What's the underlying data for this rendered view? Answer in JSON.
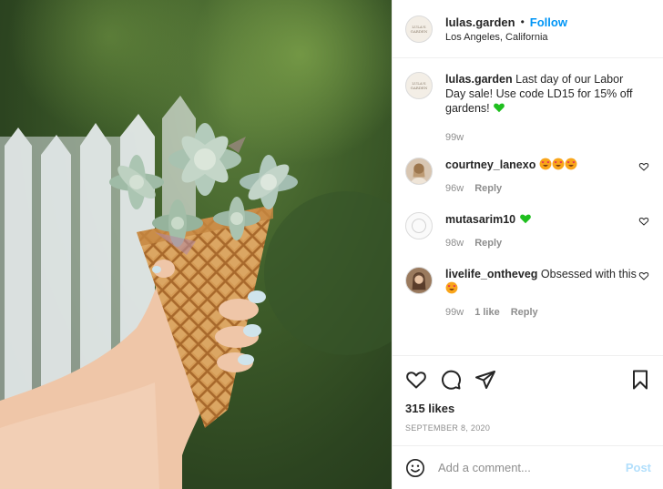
{
  "post": {
    "username": "lulas.garden",
    "dot": "•",
    "follow_label": "Follow",
    "location": "Los Angeles, California",
    "avatar_logo_text": "LULA'S GARDEN"
  },
  "caption": {
    "username": "lulas.garden",
    "text": " Last day of our Labor Day sale! Use code LD15 for 15% off gardens! ",
    "emoji": "green-heart",
    "time": "99w"
  },
  "comments": [
    {
      "username": "courtney_lanexo",
      "text": "",
      "emojis": [
        "heart-eyes",
        "heart-eyes",
        "heart-eyes"
      ],
      "time": "96w",
      "likes": "",
      "reply_label": "Reply"
    },
    {
      "username": "mutasarim10",
      "text": "",
      "emojis": [
        "green-heart"
      ],
      "time": "98w",
      "likes": "",
      "reply_label": "Reply"
    },
    {
      "username": "livelife_ontheveg",
      "text": " Obsessed with this ",
      "emojis": [
        "heart-eyes"
      ],
      "time": "99w",
      "likes": "1 like",
      "reply_label": "Reply"
    }
  ],
  "actions": {
    "icons": [
      "heart-icon",
      "comment-icon",
      "share-icon",
      "bookmark-icon"
    ],
    "likes": "315 likes",
    "date": "SEPTEMBER 8, 2020"
  },
  "add_comment": {
    "placeholder": "Add a comment...",
    "post_label": "Post"
  },
  "colors": {
    "accent": "#0095f6",
    "post_disabled": "#b2dffc",
    "muted": "#8e8e8e",
    "border": "#efefef",
    "green_heart": "#1fbf1f"
  }
}
